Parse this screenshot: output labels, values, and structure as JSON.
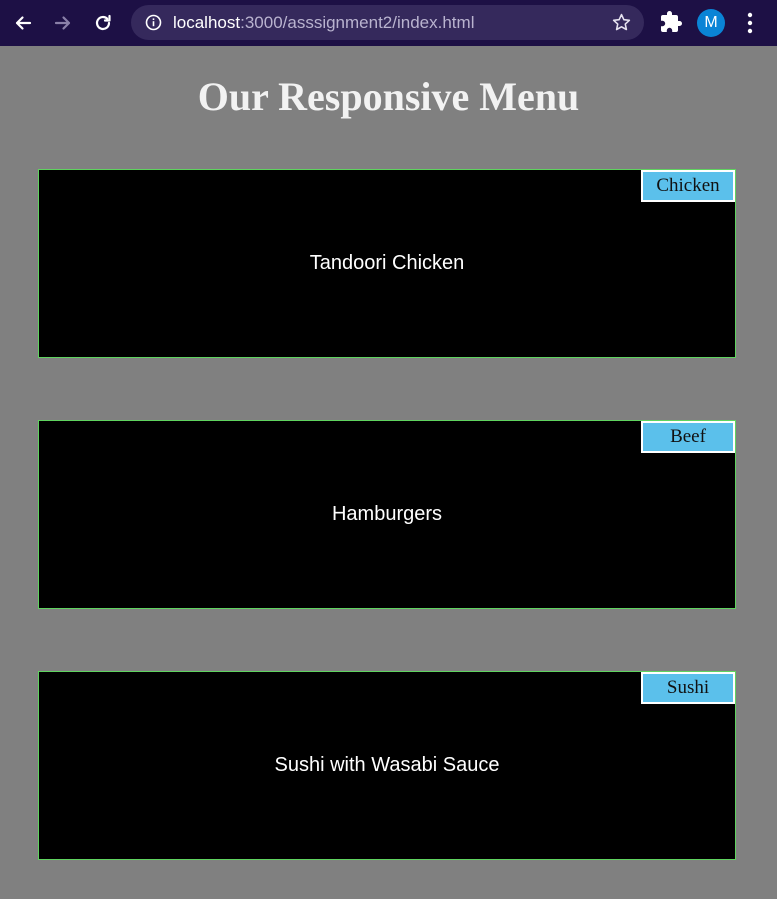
{
  "browser": {
    "url_host": "localhost",
    "url_rest": ":3000/asssignment2/index.html",
    "avatar_letter": "M",
    "icons": [
      "back-arrow-icon",
      "forward-arrow-icon",
      "reload-icon",
      "info-icon",
      "star-icon",
      "extensions-puzzle-icon",
      "more-vert-icon"
    ]
  },
  "page": {
    "title": "Our Responsive Menu",
    "items": [
      {
        "tag": "Chicken",
        "name": "Tandoori Chicken"
      },
      {
        "tag": "Beef",
        "name": "Hamburgers"
      },
      {
        "tag": "Sushi",
        "name": "Sushi with Wasabi Sauce"
      }
    ]
  },
  "colors": {
    "page_background": "#808080",
    "card_background": "#000000",
    "card_border": "#5fd35f",
    "tag_background": "#5bc0eb",
    "toolbar_background": "#1d1045"
  }
}
